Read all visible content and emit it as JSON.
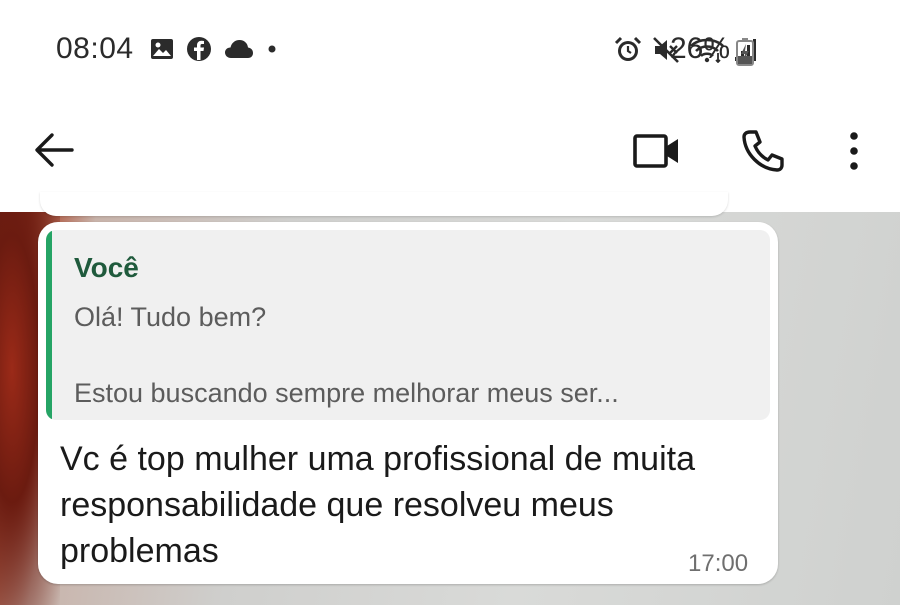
{
  "status_bar": {
    "time": "08:04",
    "battery": "26%",
    "left_icons": [
      "image-icon",
      "facebook-icon",
      "cloud-icon",
      "dot-icon"
    ],
    "right_icons": [
      "alarm-icon",
      "mute-icon",
      "wifi-icon",
      "signal-icon",
      "battery-icon"
    ]
  },
  "app_bar": {
    "actions": [
      "back-arrow-icon",
      "video-call-icon",
      "phone-call-icon",
      "more-vert-icon"
    ]
  },
  "message": {
    "quoted_author": "Você",
    "quoted_line1": "Olá! Tudo bem?",
    "quoted_line2": "Estou buscando sempre melhorar meus ser...",
    "text": "Vc é top mulher uma profissional de muita responsabilidade que resolveu meus problemas",
    "time": "17:00"
  },
  "colors": {
    "quote_bar": "#25a465",
    "quote_author": "#1f5a3c",
    "bubble": "#ffffff"
  }
}
